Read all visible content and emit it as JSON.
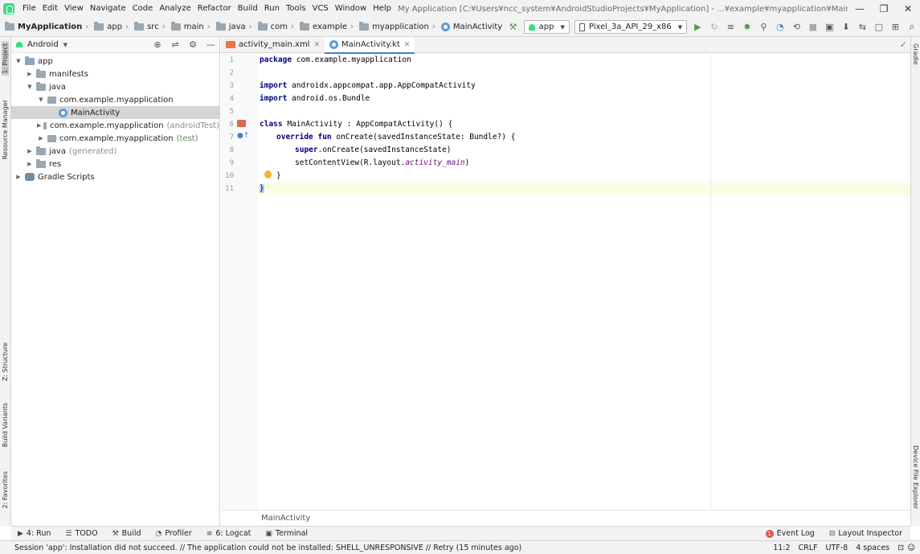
{
  "menubar": {
    "items": [
      {
        "label": "File"
      },
      {
        "label": "Edit"
      },
      {
        "label": "View"
      },
      {
        "label": "Navigate"
      },
      {
        "label": "Code"
      },
      {
        "label": "Analyze"
      },
      {
        "label": "Refactor"
      },
      {
        "label": "Build"
      },
      {
        "label": "Run"
      },
      {
        "label": "Tools"
      },
      {
        "label": "VCS"
      },
      {
        "label": "Window"
      },
      {
        "label": "Help"
      }
    ],
    "window_title": "My Application [C:¥Users¥ncc_system¥AndroidStudioProjects¥MyApplication] - ...¥example¥myapplication¥MainActivity.kt [app]",
    "minimize": "—",
    "restore": "❐",
    "close": "✕"
  },
  "navbar": {
    "crumbs": [
      "MyApplication",
      "app",
      "src",
      "main",
      "java",
      "com",
      "example",
      "myapplication",
      "MainActivity"
    ],
    "run_config": "app",
    "device": "Pixel_3a_API_29_x86"
  },
  "lefttools": {
    "project": "1: Project",
    "resource_manager": "Resource Manager",
    "structure": "Z: Structure",
    "build_variants": "Build Variants",
    "favorites": "2: Favorites"
  },
  "righttools": {
    "gradle": "Gradle",
    "device_file_explorer": "Device File Explorer"
  },
  "project": {
    "view_mode": "Android",
    "tree": [
      {
        "label": "app",
        "extra": ""
      },
      {
        "label": "manifests",
        "extra": ""
      },
      {
        "label": "java",
        "extra": ""
      },
      {
        "label": "com.example.myapplication",
        "extra": ""
      },
      {
        "label": "MainActivity",
        "extra": ""
      },
      {
        "label": "com.example.myapplication",
        "extra": "(androidTest)"
      },
      {
        "label": "com.example.myapplication",
        "extra": "(test)"
      },
      {
        "label": "java",
        "extra": "(generated)"
      },
      {
        "label": "res",
        "extra": ""
      },
      {
        "label": "Gradle Scripts",
        "extra": ""
      }
    ]
  },
  "editor": {
    "tabs": [
      {
        "label": "activity_main.xml"
      },
      {
        "label": "MainActivity.kt"
      }
    ],
    "line_numbers": [
      "1",
      "2",
      "3",
      "4",
      "5",
      "6",
      "7",
      "8",
      "9",
      "10",
      "11"
    ],
    "code": {
      "l1_kw": "package",
      "l1_rest": " com.example.myapplication",
      "l3_kw": "import",
      "l3_rest": " androidx.appcompat.app.AppCompatActivity",
      "l4_kw": "import",
      "l4_rest": " android.os.Bundle",
      "l6_kw": "class",
      "l6_rest": " MainActivity : AppCompatActivity() {",
      "l7_kw": "override fun",
      "l7_rest": " onCreate(savedInstanceState: Bundle?) {",
      "l8_kw": "super",
      "l8_rest": ".onCreate(savedInstanceState)",
      "l9_a": "setContentView(R.layout.",
      "l9_it": "activity_main",
      "l9_b": ")",
      "l10": "}",
      "l11": "}"
    },
    "breadcrumb": "MainActivity"
  },
  "toolwindows": [
    {
      "label": "4: Run"
    },
    {
      "label": "TODO"
    },
    {
      "label": "Build"
    },
    {
      "label": "Profiler"
    },
    {
      "label": "6: Logcat"
    },
    {
      "label": "Terminal"
    }
  ],
  "toolwindows_right": {
    "event_log": "Event Log",
    "event_count": "1",
    "layout_inspector": "Layout Inspector"
  },
  "status": {
    "message": "Session 'app': Installation did not succeed. // The application could not be installed: SHELL_UNRESPONSIVE // Retry (15 minutes ago)",
    "position": "11:2",
    "line_sep": "CRLF",
    "encoding": "UTF-8",
    "indent": "4 spaces"
  }
}
